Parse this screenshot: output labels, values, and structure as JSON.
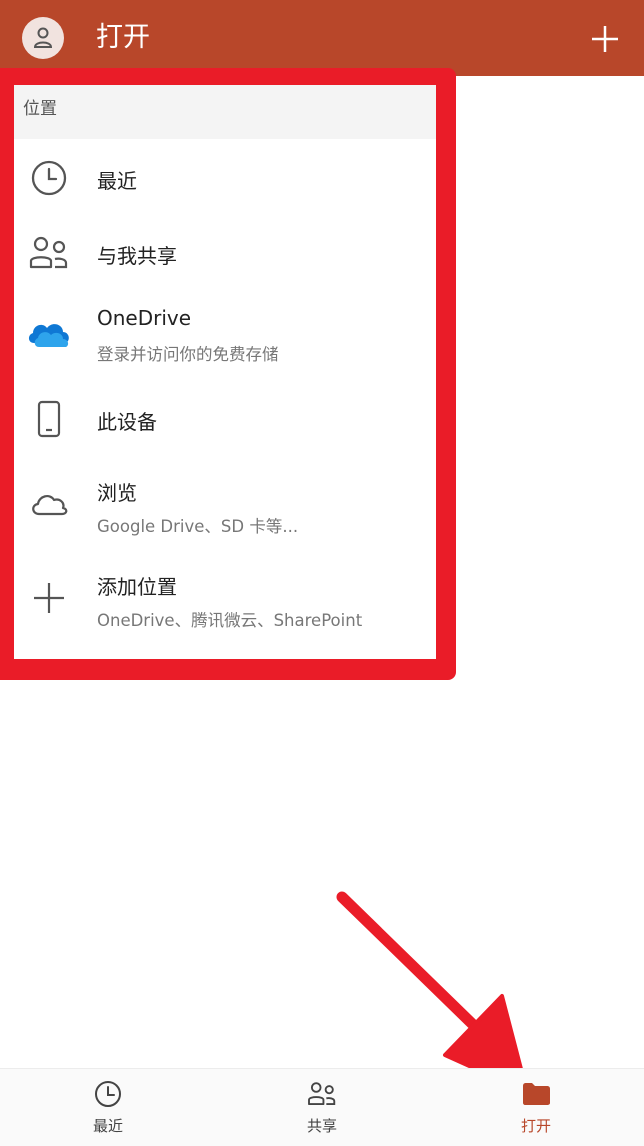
{
  "header": {
    "title": "打开",
    "avatar_icon": "person-icon",
    "add_icon": "plus-icon",
    "bg_color": "#b8472a"
  },
  "locations": {
    "section_label": "位置",
    "items": [
      {
        "title": "最近",
        "subtitle": "",
        "icon": "clock-icon"
      },
      {
        "title": "与我共享",
        "subtitle": "",
        "icon": "people-icon"
      },
      {
        "title": "OneDrive",
        "subtitle": "登录并访问你的免费存储",
        "icon": "onedrive-cloud-icon"
      },
      {
        "title": "此设备",
        "subtitle": "",
        "icon": "phone-icon"
      },
      {
        "title": "浏览",
        "subtitle": "Google Drive、SD 卡等...",
        "icon": "cloud-outline-icon"
      },
      {
        "title": "添加位置",
        "subtitle": "OneDrive、腾讯微云、SharePoint",
        "icon": "plus-icon"
      }
    ]
  },
  "bottom_nav": {
    "items": [
      {
        "label": "最近",
        "icon": "clock-icon",
        "active": false
      },
      {
        "label": "共享",
        "icon": "people-icon",
        "active": false
      },
      {
        "label": "打开",
        "icon": "folder-icon",
        "active": true
      }
    ]
  },
  "annotation": {
    "highlight_color": "#ea1c28",
    "arrow_icon": "red-arrow-annotation"
  }
}
